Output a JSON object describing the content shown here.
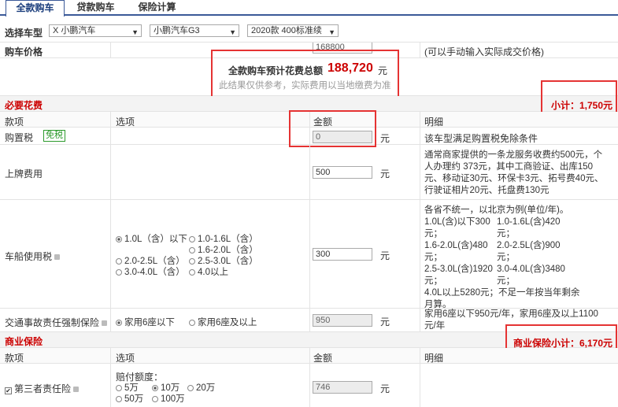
{
  "tabs": [
    "全款购车",
    "贷款购车",
    "保险计算"
  ],
  "select_label": "选择车型",
  "selects": {
    "brand": "X 小鹏汽车",
    "model": "小鹏汽车G3",
    "version": "2020款 400标准续"
  },
  "price": {
    "label": "购车价格",
    "value": "168800",
    "hint": "(可以手动输入实际成交价格)"
  },
  "summary": {
    "label": "全款购车预计花费总额",
    "value": "188,720",
    "unit": "元",
    "note": "此结果仅供参考，实际费用以当地缴费为准"
  },
  "required": {
    "title": "必要花费",
    "subtotal": "小计：1,750元"
  },
  "headers": {
    "item": "款项",
    "option": "选项",
    "amount": "金额",
    "detail": "明细"
  },
  "unit": "元",
  "purchase_tax": {
    "label": "购置税",
    "badge": "免税",
    "value": "0",
    "detail": "该车型满足购置税免除条件"
  },
  "plate": {
    "label": "上牌费用",
    "value": "500",
    "detail": [
      "通常商家提供的一条龙服务收费约500元，个",
      "人办理约 373元，其中工商验证、出库150",
      "元、移动证30元、环保卡3元、拓号费40元、",
      "行驶证相片20元、托盘费130元"
    ]
  },
  "vehicle_tax": {
    "label": "车船使用税",
    "value": "300",
    "options": [
      "1.0L（含）以下",
      "1.0-1.6L（含）",
      "1.6-2.0L（含）",
      "2.0-2.5L（含）",
      "2.5-3.0L（含）",
      "3.0-4.0L（含）",
      "4.0以上"
    ],
    "detail": [
      "各省不统一，以北京为例(单位/年)。",
      "1.0L(含)以下300",
      "元；",
      "1.6-2.0L(含)480",
      "元；",
      "2.5-3.0L(含)1920",
      "元；",
      "4.0L以上5280元；不足一年按当年剩余",
      "月算。"
    ],
    "detail2": [
      "1.0-1.6L(含)420",
      "元；",
      "2.0-2.5L(含)900",
      "元；",
      "3.0-4.0L(含)3480",
      "元；"
    ]
  },
  "compulsory": {
    "label": "交通事故责任强制保险",
    "options": [
      "家用6座以下",
      "家用6座及以上"
    ],
    "value": "950",
    "detail": [
      "家用6座以下950元/年，家用6座及以上1100",
      "元/年"
    ]
  },
  "commercial": {
    "title": "商业保险",
    "subtotal": "商业保险小计：6,170元"
  },
  "third_party": {
    "label": "第三者责任险",
    "sub": "赔付额度：",
    "options": [
      "5万",
      "10万",
      "20万",
      "50万",
      "100万"
    ],
    "value": "746"
  }
}
